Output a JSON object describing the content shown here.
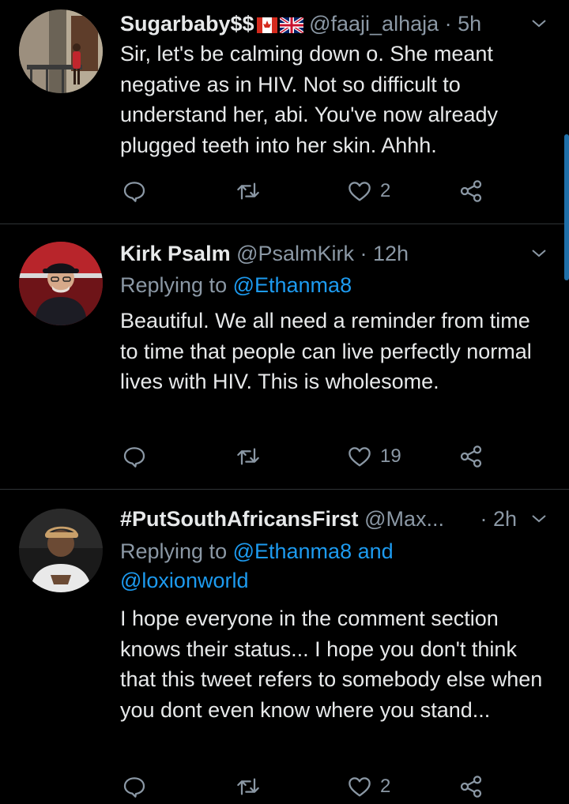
{
  "tweets": [
    {
      "name": "Sugarbaby$$",
      "handle": "@faaji_alhaja",
      "time": "· 5h",
      "reply_prefix": "",
      "reply_to": "",
      "body": "Sir, let's be calming down o. She meant negative as in HIV. Not so difficult to understand her, abi. You've now already plugged teeth into her skin. Ahhh.",
      "likes": "2",
      "flags": [
        "canada-flag-icon",
        "uk-flag-icon"
      ]
    },
    {
      "name": "Kirk Psalm",
      "handle": "@PsalmKirk",
      "time": "· 12h",
      "reply_prefix": "Replying to ",
      "reply_to": "@Ethanma8",
      "body": "Beautiful. We all need a reminder from time to time that people can live perfectly normal lives with HIV. This is wholesome.",
      "likes": "19"
    },
    {
      "name": "#PutSouthAfricansFirst",
      "handle": "@Max...",
      "time": "· 2h",
      "reply_prefix": "Replying to ",
      "reply_to": "@Ethanma8 and",
      "reply_to_line2": "@loxionworld",
      "body": "I hope everyone in the comment section knows their status... I hope you don't think that this tweet refers to somebody else when you dont even know where you stand...",
      "likes": "2"
    }
  ],
  "icons": {
    "reply": "reply-icon",
    "retweet": "retweet-icon",
    "like": "heart-icon",
    "share": "share-icon",
    "more": "chevron-down-icon"
  },
  "colors": {
    "background": "#000000",
    "text": "#e7e9ea",
    "secondary": "#8b98a5",
    "link": "#1d9bf0",
    "divider": "#2f3336"
  }
}
